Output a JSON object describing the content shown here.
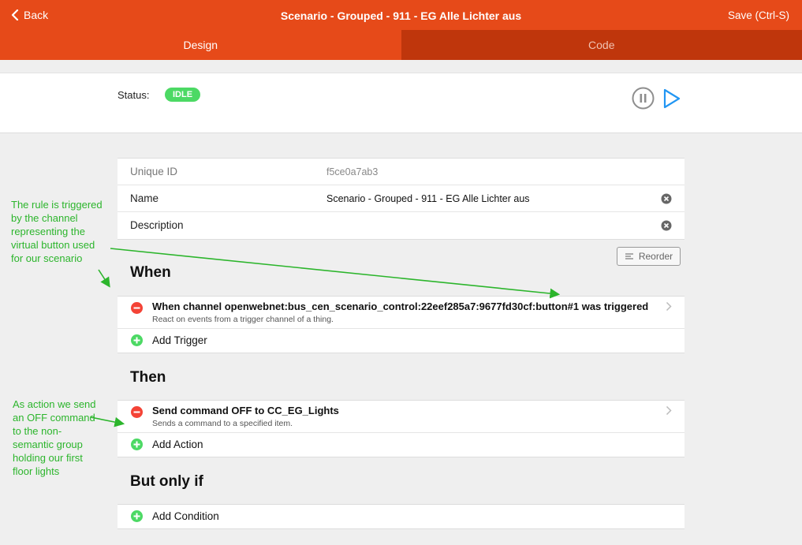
{
  "header": {
    "back_label": "Back",
    "title": "Scenario - Grouped - 911 - EG Alle Lichter aus",
    "save_label": "Save (Ctrl-S)"
  },
  "tabs": [
    {
      "label": "Design",
      "active": true
    },
    {
      "label": "Code",
      "active": false
    }
  ],
  "status": {
    "label": "Status:",
    "value": "IDLE",
    "badge_color": "#4cd964"
  },
  "info": {
    "unique_id_label": "Unique ID",
    "unique_id_value": "f5ce0a7ab3",
    "name_label": "Name",
    "name_value": "Scenario - Grouped - 911 - EG Alle Lichter aus",
    "description_label": "Description",
    "description_value": ""
  },
  "reorder_label": "Reorder",
  "sections": {
    "when": {
      "title": "When",
      "rule_title": "When channel openwebnet:bus_cen_scenario_control:22eef285a7:9677fd30cf:button#1 was triggered",
      "rule_subtitle": "React on events from a trigger channel of a thing.",
      "add_label": "Add Trigger"
    },
    "then": {
      "title": "Then",
      "rule_title": "Send command OFF to CC_EG_Lights",
      "rule_subtitle": "Sends a command to a specified item.",
      "add_label": "Add Action"
    },
    "only_if": {
      "title": "But only if",
      "add_label": "Add Condition"
    }
  },
  "annotations": {
    "trigger_note": "The rule is triggered by the channel representing the virtual button used for our scenario",
    "action_note": "As action we send an OFF command to the non-semantic group holding our first floor lights"
  },
  "colors": {
    "brand": "#e64a19",
    "tab_inactive": "#bf360c",
    "accent_blue": "#2196f3",
    "remove_red": "#f44336",
    "add_green": "#4cd964",
    "annotation_green": "#2cb52c"
  }
}
